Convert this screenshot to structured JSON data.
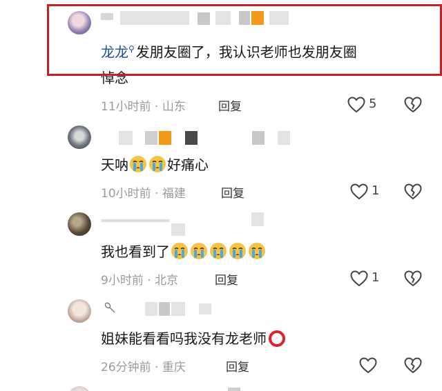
{
  "comments": [
    {
      "text_mention": "龙龙",
      "text_body": "发朋友圈了，我认识老师也发朋友圈",
      "text_body2": "悼念",
      "time": "11小时前",
      "location": "山东",
      "reply_label": "回复",
      "likes": "5"
    },
    {
      "text_start": "天呐",
      "text_end": "好痛心",
      "time": "10小时前",
      "location": "福建",
      "reply_label": "回复",
      "likes": "1"
    },
    {
      "text_start": "我也看到了",
      "time": "9小时前",
      "location": "北京",
      "reply_label": "回复",
      "likes": "1"
    },
    {
      "text_start": "姐妹能看看吗我没有龙老师",
      "time": "26分钟前",
      "location": "重庆",
      "reply_label": "回复",
      "likes": ""
    }
  ],
  "separator": " · ",
  "colors": {
    "highlight": "#c81f1f",
    "mention": "#1e4f8f",
    "meta": "#9a9a9a",
    "emoji": "#f6c445"
  },
  "icons": [
    "heart-outline-icon",
    "broken-heart-icon",
    "crying-face-emoji",
    "red-circle-emoji",
    "spoon-sticker-icon"
  ]
}
